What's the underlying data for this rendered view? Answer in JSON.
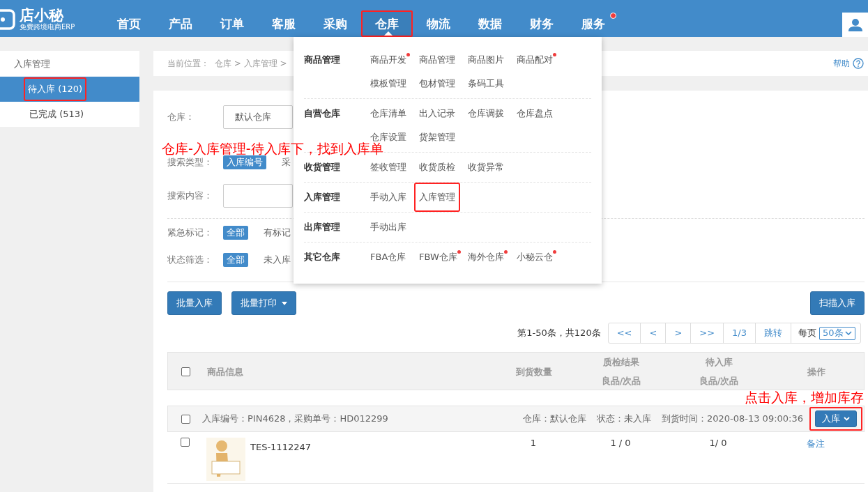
{
  "logo": {
    "name": "店小秘",
    "tagline": "免费跨境电商ERP"
  },
  "nav": [
    {
      "label": "首页",
      "selected": false,
      "highlighted": false,
      "dot": false
    },
    {
      "label": "产品",
      "selected": false,
      "highlighted": false,
      "dot": false
    },
    {
      "label": "订单",
      "selected": false,
      "highlighted": false,
      "dot": false
    },
    {
      "label": "客服",
      "selected": false,
      "highlighted": false,
      "dot": false
    },
    {
      "label": "采购",
      "selected": false,
      "highlighted": false,
      "dot": false
    },
    {
      "label": "仓库",
      "selected": true,
      "highlighted": true,
      "dot": false
    },
    {
      "label": "物流",
      "selected": false,
      "highlighted": false,
      "dot": false
    },
    {
      "label": "数据",
      "selected": false,
      "highlighted": false,
      "dot": false
    },
    {
      "label": "财务",
      "selected": false,
      "highlighted": false,
      "dot": false
    },
    {
      "label": "服务",
      "selected": false,
      "highlighted": false,
      "dot": true
    }
  ],
  "sidebar": {
    "heading": "入库管理",
    "items": [
      {
        "label": "待入库 (120)",
        "selected": true,
        "highlighted": true
      },
      {
        "label": "已完成 (513)",
        "selected": false,
        "highlighted": false
      }
    ]
  },
  "breadcrumb": {
    "label": "当前位置：",
    "path": "仓库 > 入库管理 >",
    "help": "帮助"
  },
  "filter_note": "仓库-入库管理-待入库下，找到入库单",
  "filter_groups": [
    {
      "filters": [
        {
          "kind": "select",
          "label": "仓库：",
          "value": "默认仓库"
        },
        {
          "kind": "options",
          "label": "搜索类型：",
          "options": [
            {
              "label": "入库编号",
              "selected": true
            },
            {
              "label": "采",
              "selected": false
            }
          ]
        },
        {
          "kind": "input",
          "label": "搜索内容："
        }
      ]
    },
    {
      "filters": [
        {
          "kind": "options",
          "label": "紧急标记：",
          "options": [
            {
              "label": "全部",
              "selected": true
            },
            {
              "label": "有标记",
              "selected": false
            }
          ]
        },
        {
          "kind": "options",
          "label": "状态筛选：",
          "options": [
            {
              "label": "全部",
              "selected": true
            },
            {
              "label": "未入库",
              "selected": false
            }
          ]
        }
      ]
    }
  ],
  "menu": {
    "groups": [
      {
        "title": "商品管理",
        "items": [
          {
            "label": "商品开发",
            "dot": true,
            "highlighted": false
          },
          {
            "label": "商品管理",
            "dot": false,
            "highlighted": false
          },
          {
            "label": "商品图片",
            "dot": false,
            "highlighted": false
          },
          {
            "label": "商品配对",
            "dot": true,
            "highlighted": false
          },
          {
            "label": "模板管理",
            "dot": false,
            "highlighted": false
          },
          {
            "label": "包材管理",
            "dot": false,
            "highlighted": false
          },
          {
            "label": "条码工具",
            "dot": false,
            "highlighted": false
          }
        ]
      },
      {
        "title": "自营仓库",
        "items": [
          {
            "label": "仓库清单",
            "dot": false,
            "highlighted": false
          },
          {
            "label": "出入记录",
            "dot": false,
            "highlighted": false
          },
          {
            "label": "仓库调拨",
            "dot": false,
            "highlighted": false
          },
          {
            "label": "仓库盘点",
            "dot": false,
            "highlighted": false
          },
          {
            "label": "仓库设置",
            "dot": false,
            "highlighted": false
          },
          {
            "label": "货架管理",
            "dot": false,
            "highlighted": false
          }
        ]
      },
      {
        "title": "收货管理",
        "items": [
          {
            "label": "签收管理",
            "dot": false,
            "highlighted": false
          },
          {
            "label": "收货质检",
            "dot": false,
            "highlighted": false
          },
          {
            "label": "收货异常",
            "dot": false,
            "highlighted": false
          }
        ]
      },
      {
        "title": "入库管理",
        "items": [
          {
            "label": "手动入库",
            "dot": false,
            "highlighted": false
          },
          {
            "label": "入库管理",
            "dot": false,
            "highlighted": true
          }
        ]
      },
      {
        "title": "出库管理",
        "items": [
          {
            "label": "手动出库",
            "dot": false,
            "highlighted": false
          }
        ]
      },
      {
        "title": "其它仓库",
        "items": [
          {
            "label": "FBA仓库",
            "dot": false,
            "highlighted": false
          },
          {
            "label": "FBW仓库",
            "dot": true,
            "highlighted": false
          },
          {
            "label": "海外仓库",
            "dot": true,
            "highlighted": false
          },
          {
            "label": "小秘云仓",
            "dot": true,
            "highlighted": false
          }
        ]
      }
    ]
  },
  "toolbar": {
    "buttons": [
      {
        "label": "批量入库",
        "kind": "plain"
      },
      {
        "label": "批量打印",
        "kind": "dropdown"
      }
    ],
    "scan_button": "扫描入库"
  },
  "pagination": {
    "summary": "第1-50条，共120条",
    "buttons": [
      "<<",
      "<",
      ">",
      ">>"
    ],
    "page": "1/3",
    "jump": "跳转",
    "per_page_label": "每页",
    "per_page": "50条"
  },
  "table": {
    "checked": false,
    "columns": [
      {
        "label": "商品信息"
      },
      {
        "label": "到货数量"
      },
      {
        "label": "质检结果",
        "sublabel": "良品/次品"
      },
      {
        "label": "待入库",
        "sublabel": "良品/次品"
      },
      {
        "label": "操作"
      }
    ],
    "note": "点击入库，增加库存",
    "orders": [
      {
        "info": "入库编号：PIN4628，采购单号：HD012299",
        "warehouse": "仓库：默认仓库",
        "status": "状态：未入库",
        "arrival": "到货时间：2020-08-13 09:00:36",
        "action": "入库",
        "checked": false,
        "highlighted": true,
        "items": [
          {
            "sku": "TES-1112247",
            "qty": "1",
            "qc": "1 / 0",
            "pending": "1/ 0",
            "link": "备注",
            "checked": false
          }
        ]
      }
    ]
  }
}
